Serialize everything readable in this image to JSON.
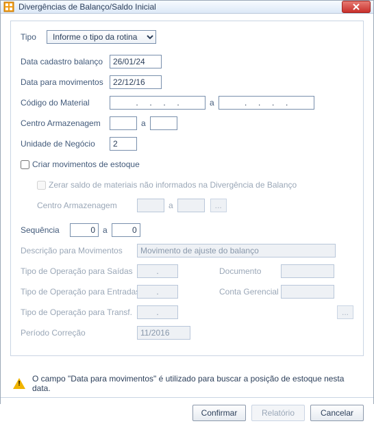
{
  "window": {
    "title": "Divergências de Balanço/Saldo Inicial"
  },
  "fields": {
    "tipo_label": "Tipo",
    "tipo_value": "Informe o tipo da rotina",
    "data_cadastro_label": "Data cadastro balanço",
    "data_cadastro_value": "26/01/24",
    "data_mov_label": "Data para movimentos",
    "data_mov_value": "22/12/16",
    "codigo_material_label": "Código do Material",
    "codigo_material_from": ".     .     .     .",
    "codigo_material_sep": "a",
    "codigo_material_to": ".     .     .     .",
    "centro_arm_label": "Centro Armazenagem",
    "centro_arm_from": "",
    "centro_arm_sep": "a",
    "centro_arm_to": "",
    "unidade_negocio_label": "Unidade de Negócio",
    "unidade_negocio_value": "2",
    "criar_mov_label": "Criar movimentos de estoque",
    "zerar_saldo_label": "Zerar saldo de materiais não informados na Divergência de Balanço",
    "centro_arm2_label": "Centro Armazenagem",
    "centro_arm2_from": "",
    "centro_arm2_sep": "a",
    "centro_arm2_to": "",
    "centro_arm2_btn": "...",
    "sequencia_label": "Sequência",
    "sequencia_from": "0",
    "sequencia_sep": "a",
    "sequencia_to": "0",
    "descricao_mov_label": "Descrição para Movimentos",
    "descricao_mov_value": "Movimento de ajuste do balanço",
    "tipo_op_saidas_label": "Tipo de Operação para Saídas",
    "tipo_op_saidas_value": ".",
    "documento_label": "Documento",
    "documento_value": "",
    "tipo_op_entradas_label": "Tipo de Operação para Entradas",
    "tipo_op_entradas_value": ".",
    "conta_gerencial_label": "Conta Gerencial",
    "conta_gerencial_value": "",
    "conta_gerencial_btn": "...",
    "tipo_op_transf_label": "Tipo de Operação para Transf.",
    "tipo_op_transf_value": ".",
    "periodo_correcao_label": "Período Correção",
    "periodo_correcao_value": "11/2016"
  },
  "warning": {
    "text": "O campo \"Data para movimentos\" é utilizado para buscar a posição de estoque nesta data."
  },
  "buttons": {
    "confirmar": "Confirmar",
    "relatorio": "Relatório",
    "cancelar": "Cancelar"
  }
}
